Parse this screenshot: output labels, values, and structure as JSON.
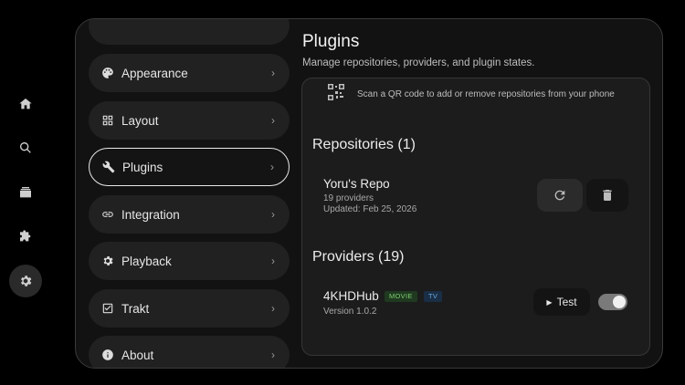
{
  "rail": [
    {
      "icon": "home-icon"
    },
    {
      "icon": "search-icon"
    },
    {
      "icon": "library-icon"
    },
    {
      "icon": "puzzle-icon"
    },
    {
      "icon": "gear-icon",
      "active": true
    }
  ],
  "settings_menu": [
    {
      "label": "Appearance",
      "icon": "palette-icon"
    },
    {
      "label": "Layout",
      "icon": "grid-icon"
    },
    {
      "label": "Plugins",
      "icon": "wrench-icon",
      "active": true
    },
    {
      "label": "Integration",
      "icon": "link-icon"
    },
    {
      "label": "Playback",
      "icon": "gear-icon"
    },
    {
      "label": "Trakt",
      "icon": "checkbox-icon"
    },
    {
      "label": "About",
      "icon": "info-icon"
    }
  ],
  "page": {
    "title": "Plugins",
    "subtitle": "Manage repositories, providers, and plugin states."
  },
  "qr": {
    "text": "Scan a QR code to add or remove repositories from your phone"
  },
  "repositories": {
    "title": "Repositories (1)",
    "items": [
      {
        "name": "Yoru's Repo",
        "providers": "19 providers",
        "updated": "Updated: Feb 25, 2026"
      }
    ]
  },
  "providers": {
    "title": "Providers (19)",
    "items": [
      {
        "name": "4KHDHub",
        "badges": [
          "MOVIE",
          "TV"
        ],
        "version": "Version 1.0.2",
        "test_label": "Test",
        "enabled": true
      }
    ]
  },
  "colors": {
    "background": "#000000",
    "panel": "#121212",
    "badge_movie": "#7ecb6f",
    "badge_tv": "#6aa9e0"
  }
}
